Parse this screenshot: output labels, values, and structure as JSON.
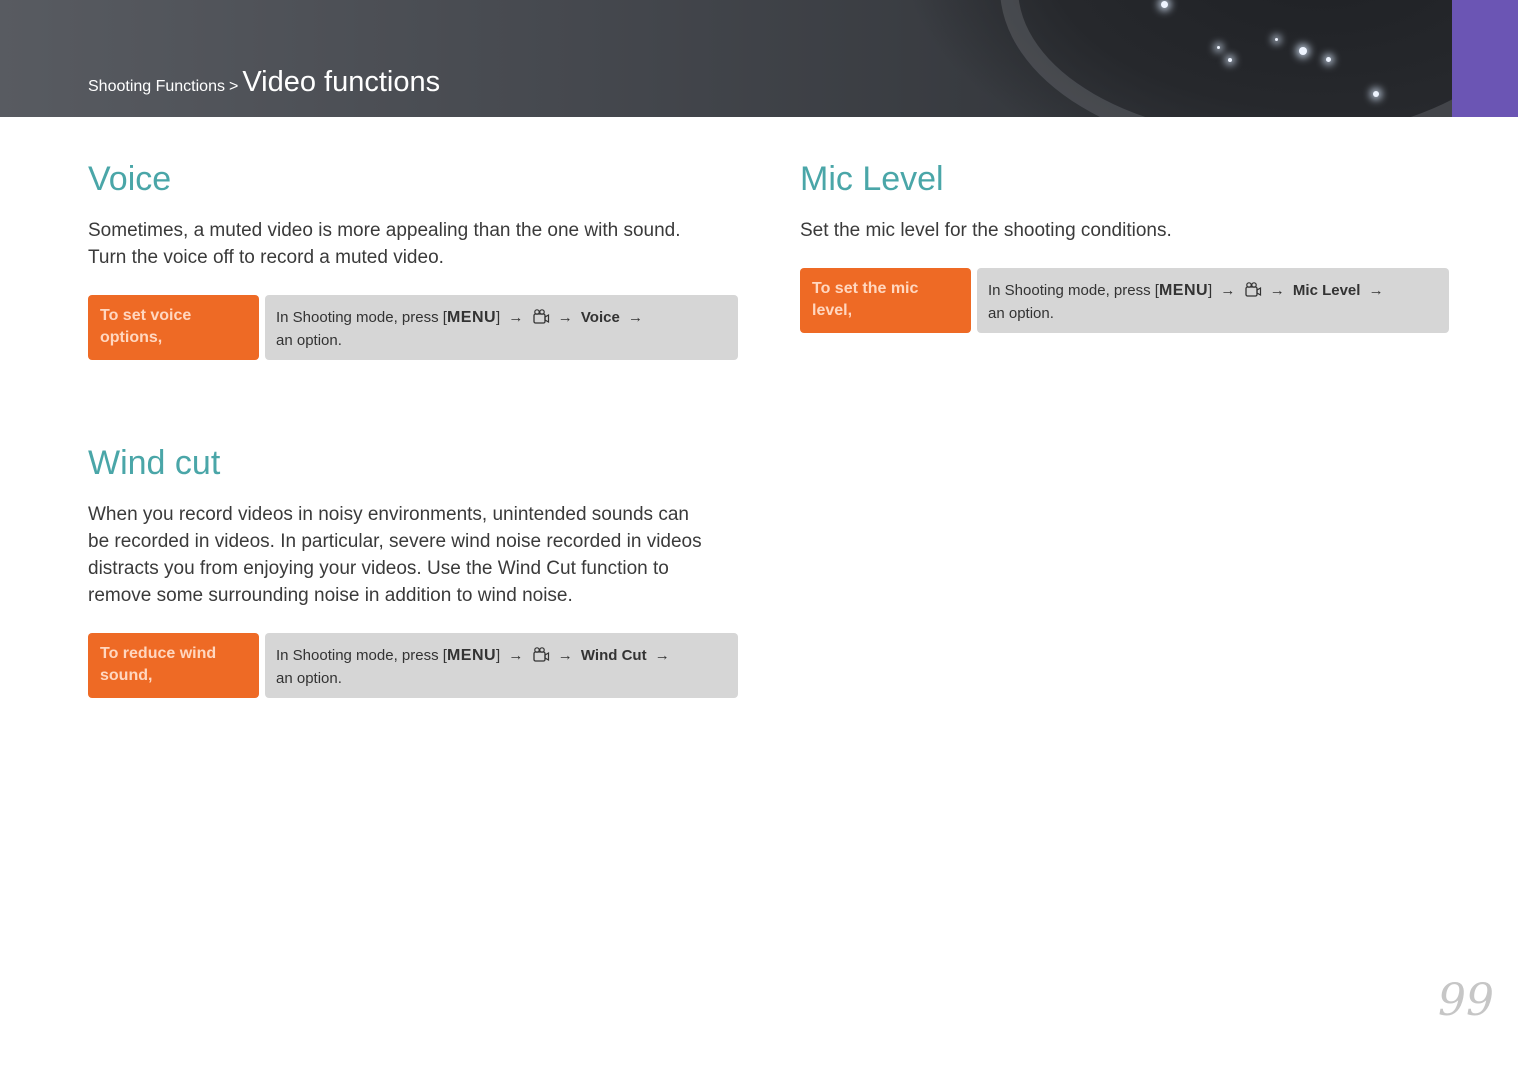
{
  "header": {
    "breadcrumb_parent": "Shooting Functions",
    "separator": ">",
    "breadcrumb_current": "Video functions",
    "accent_color": "#6b55b4"
  },
  "sections": {
    "voice": {
      "title": "Voice",
      "text_lines": [
        "Sometimes, a muted video is more appealing than the one with sound.",
        "Turn the voice off to record a muted video."
      ],
      "howto_label_lines": [
        "To set voice",
        "options,"
      ],
      "steps": {
        "prefix": "In Shooting mode, press [",
        "menu_key": "MENU",
        "after_menu": "]",
        "arrow": "→",
        "target": "Voice",
        "suffix": "an option."
      }
    },
    "wind_cut": {
      "title": "Wind cut",
      "text_lines": [
        "When you record videos in noisy environments, unintended sounds can",
        "be recorded in videos. In particular, severe wind noise recorded in videos",
        "distracts you from enjoying your videos. Use the Wind Cut function to",
        "remove some surrounding noise in addition to wind noise."
      ],
      "howto_label_lines": [
        "To reduce wind",
        "sound,"
      ],
      "steps": {
        "prefix": "In Shooting mode, press [",
        "menu_key": "MENU",
        "after_menu": "]",
        "arrow": "→",
        "target": "Wind Cut",
        "suffix": "an option."
      }
    },
    "mic_level": {
      "title": "Mic Level",
      "text_lines": [
        "Set the mic level for the shooting conditions."
      ],
      "howto_label_lines": [
        "To set the mic",
        "level,"
      ],
      "steps": {
        "prefix": "In Shooting mode, press [",
        "menu_key": "MENU",
        "after_menu": "]",
        "arrow": "→",
        "target": "Mic Level",
        "suffix": "an option."
      }
    }
  },
  "icons": {
    "menu_button": "menu-key-icon",
    "video_menu": "movie-camera-icon"
  },
  "colors": {
    "heading": "#4aa6a8",
    "label_bg": "#ee6a25",
    "steps_bg": "#d6d6d6"
  },
  "page_number": "99"
}
